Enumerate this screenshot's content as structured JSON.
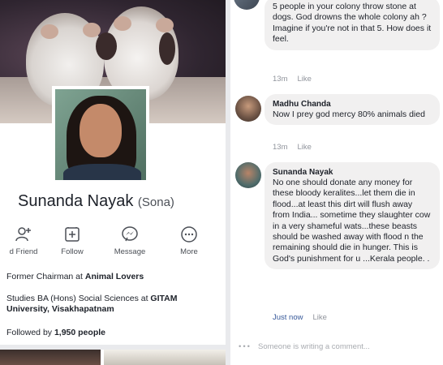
{
  "profile": {
    "name": "Sunanda Nayak",
    "nickname": "(Sona)",
    "actions": [
      {
        "label": "d Friend",
        "icon": "add-friend-icon"
      },
      {
        "label": "Follow",
        "icon": "follow-icon"
      },
      {
        "label": "Message",
        "icon": "messenger-icon"
      },
      {
        "label": "More",
        "icon": "more-icon"
      }
    ],
    "about": {
      "work_prefix": "Former Chairman at ",
      "work_place": "Animal Lovers",
      "study_prefix": "Studies BA (Hons) Social Sciences at ",
      "study_place": "GITAM University, Visakhapatnam",
      "followers_prefix": "Followed by ",
      "followers_count": "1,950 people"
    }
  },
  "comments": [
    {
      "name": "",
      "text": "5 people in your colony throw stone at dogs. God drowns the whole colony ah ? Imagine if you're not in that 5. How does it feel.",
      "time": "13m",
      "like_label": "Like"
    },
    {
      "name": "Madhu Chanda",
      "text": "Now I prey god mercy 80% animals died",
      "time": "13m",
      "like_label": "Like"
    },
    {
      "name": "Sunanda Nayak",
      "text": "No one should donate any money for these bloody keralites...let them die in flood...at least this dirt will flush away from India... sometime they slaughter cow in a very shameful wats...these beasts should be washed away with flood n the remaining should die in hunger. This is God's punishment for u ...Kerala people. .",
      "time": "Just now",
      "like_label": "Like"
    }
  ],
  "comment_input": {
    "placeholder": "Someone is writing a comment..."
  },
  "colors": {
    "bubble": "#f1f0f0",
    "meta_text": "#90949c",
    "link_blue": "#365899"
  }
}
